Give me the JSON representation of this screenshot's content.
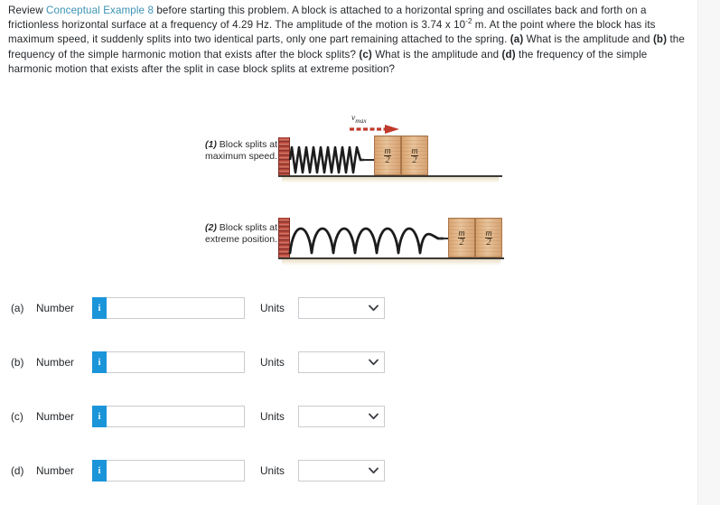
{
  "problem": {
    "lead": "Review ",
    "link_text": "Conceptual Example 8",
    "sentence_1": " before starting this problem. A block is attached to a horizontal spring and oscillates back and forth on a frictionless horizontal surface at a frequency of 4.29 Hz. The amplitude of the motion is 3.74 x 10",
    "exponent": "-2",
    "sentence_2": " m. At the point where the block has its maximum speed, it suddenly splits into two identical parts, only one part remaining attached to the spring. ",
    "label_a": "(a)",
    "sentence_3": " What is the amplitude and ",
    "label_b": "(b)",
    "sentence_4": " the frequency of the simple harmonic motion that exists after the block splits? ",
    "label_c": "(c)",
    "sentence_5": " What is the amplitude and ",
    "label_d": "(d)",
    "sentence_6": " the frequency of the simple harmonic motion that exists after the split in case block splits at extreme position?"
  },
  "figure": {
    "caption_1": {
      "number": "(1)",
      "line_1": " Block splits at",
      "line_2": "maximum speed."
    },
    "caption_2": {
      "number": "(2)",
      "line_1": " Block splits at",
      "line_2": "extreme position."
    },
    "vmax": {
      "symbol": "v",
      "subscript": "max"
    },
    "block_mass_label": {
      "numerator": "m",
      "denominator": "2"
    },
    "colors": {
      "wall": "#a33d33",
      "spring": "#1c1c1c",
      "block": "#d9a470",
      "ground": "#3c3a36",
      "arrow": "#c0392b"
    }
  },
  "answers": {
    "number_label": "Number",
    "units_label": "Units",
    "info_icon": "i",
    "rows": [
      {
        "letter": "(a)",
        "value": "",
        "placeholder": "",
        "unit_selected": "",
        "unit_options": [
          ""
        ]
      },
      {
        "letter": "(b)",
        "value": "",
        "placeholder": "",
        "unit_selected": "",
        "unit_options": [
          ""
        ]
      },
      {
        "letter": "(c)",
        "value": "",
        "placeholder": "",
        "unit_selected": "",
        "unit_options": [
          ""
        ]
      },
      {
        "letter": "(d)",
        "value": "",
        "placeholder": "",
        "unit_selected": "",
        "unit_options": [
          ""
        ]
      }
    ]
  }
}
